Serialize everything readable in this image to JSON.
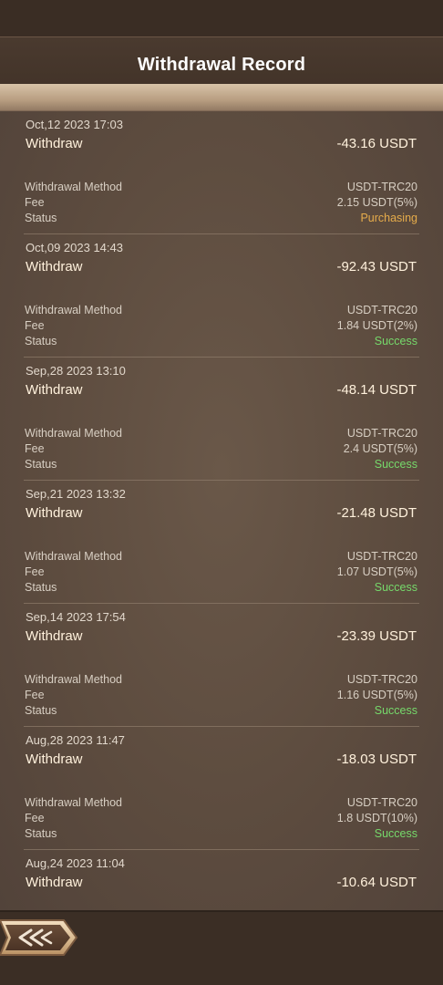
{
  "header": {
    "title": "Withdrawal Record"
  },
  "labels": {
    "method": "Withdrawal Method",
    "fee": "Fee",
    "status": "Status"
  },
  "records": [
    {
      "date": "Oct,12 2023 17:03",
      "type": "Withdraw",
      "amount": "-43.16 USDT",
      "method": "USDT-TRC20",
      "fee": "2.15 USDT(5%)",
      "status": "Purchasing",
      "status_kind": "purchasing"
    },
    {
      "date": "Oct,09 2023 14:43",
      "type": "Withdraw",
      "amount": "-92.43 USDT",
      "method": "USDT-TRC20",
      "fee": "1.84 USDT(2%)",
      "status": "Success",
      "status_kind": "success"
    },
    {
      "date": "Sep,28 2023 13:10",
      "type": "Withdraw",
      "amount": "-48.14 USDT",
      "method": "USDT-TRC20",
      "fee": "2.4 USDT(5%)",
      "status": "Success",
      "status_kind": "success"
    },
    {
      "date": "Sep,21 2023 13:32",
      "type": "Withdraw",
      "amount": "-21.48 USDT",
      "method": "USDT-TRC20",
      "fee": "1.07 USDT(5%)",
      "status": "Success",
      "status_kind": "success"
    },
    {
      "date": "Sep,14 2023 17:54",
      "type": "Withdraw",
      "amount": "-23.39 USDT",
      "method": "USDT-TRC20",
      "fee": "1.16 USDT(5%)",
      "status": "Success",
      "status_kind": "success"
    },
    {
      "date": "Aug,28 2023 11:47",
      "type": "Withdraw",
      "amount": "-18.03 USDT",
      "method": "USDT-TRC20",
      "fee": "1.8 USDT(10%)",
      "status": "Success",
      "status_kind": "success"
    },
    {
      "date": "Aug,24 2023 11:04",
      "type": "Withdraw",
      "amount": "-10.64 USDT"
    }
  ],
  "colors": {
    "success": "#76d96b",
    "purchasing": "#e6ac4b",
    "text_primary": "#fff1dc",
    "text_secondary": "#d8cfc3"
  },
  "icons": {
    "back": "back-arrow-icon"
  }
}
